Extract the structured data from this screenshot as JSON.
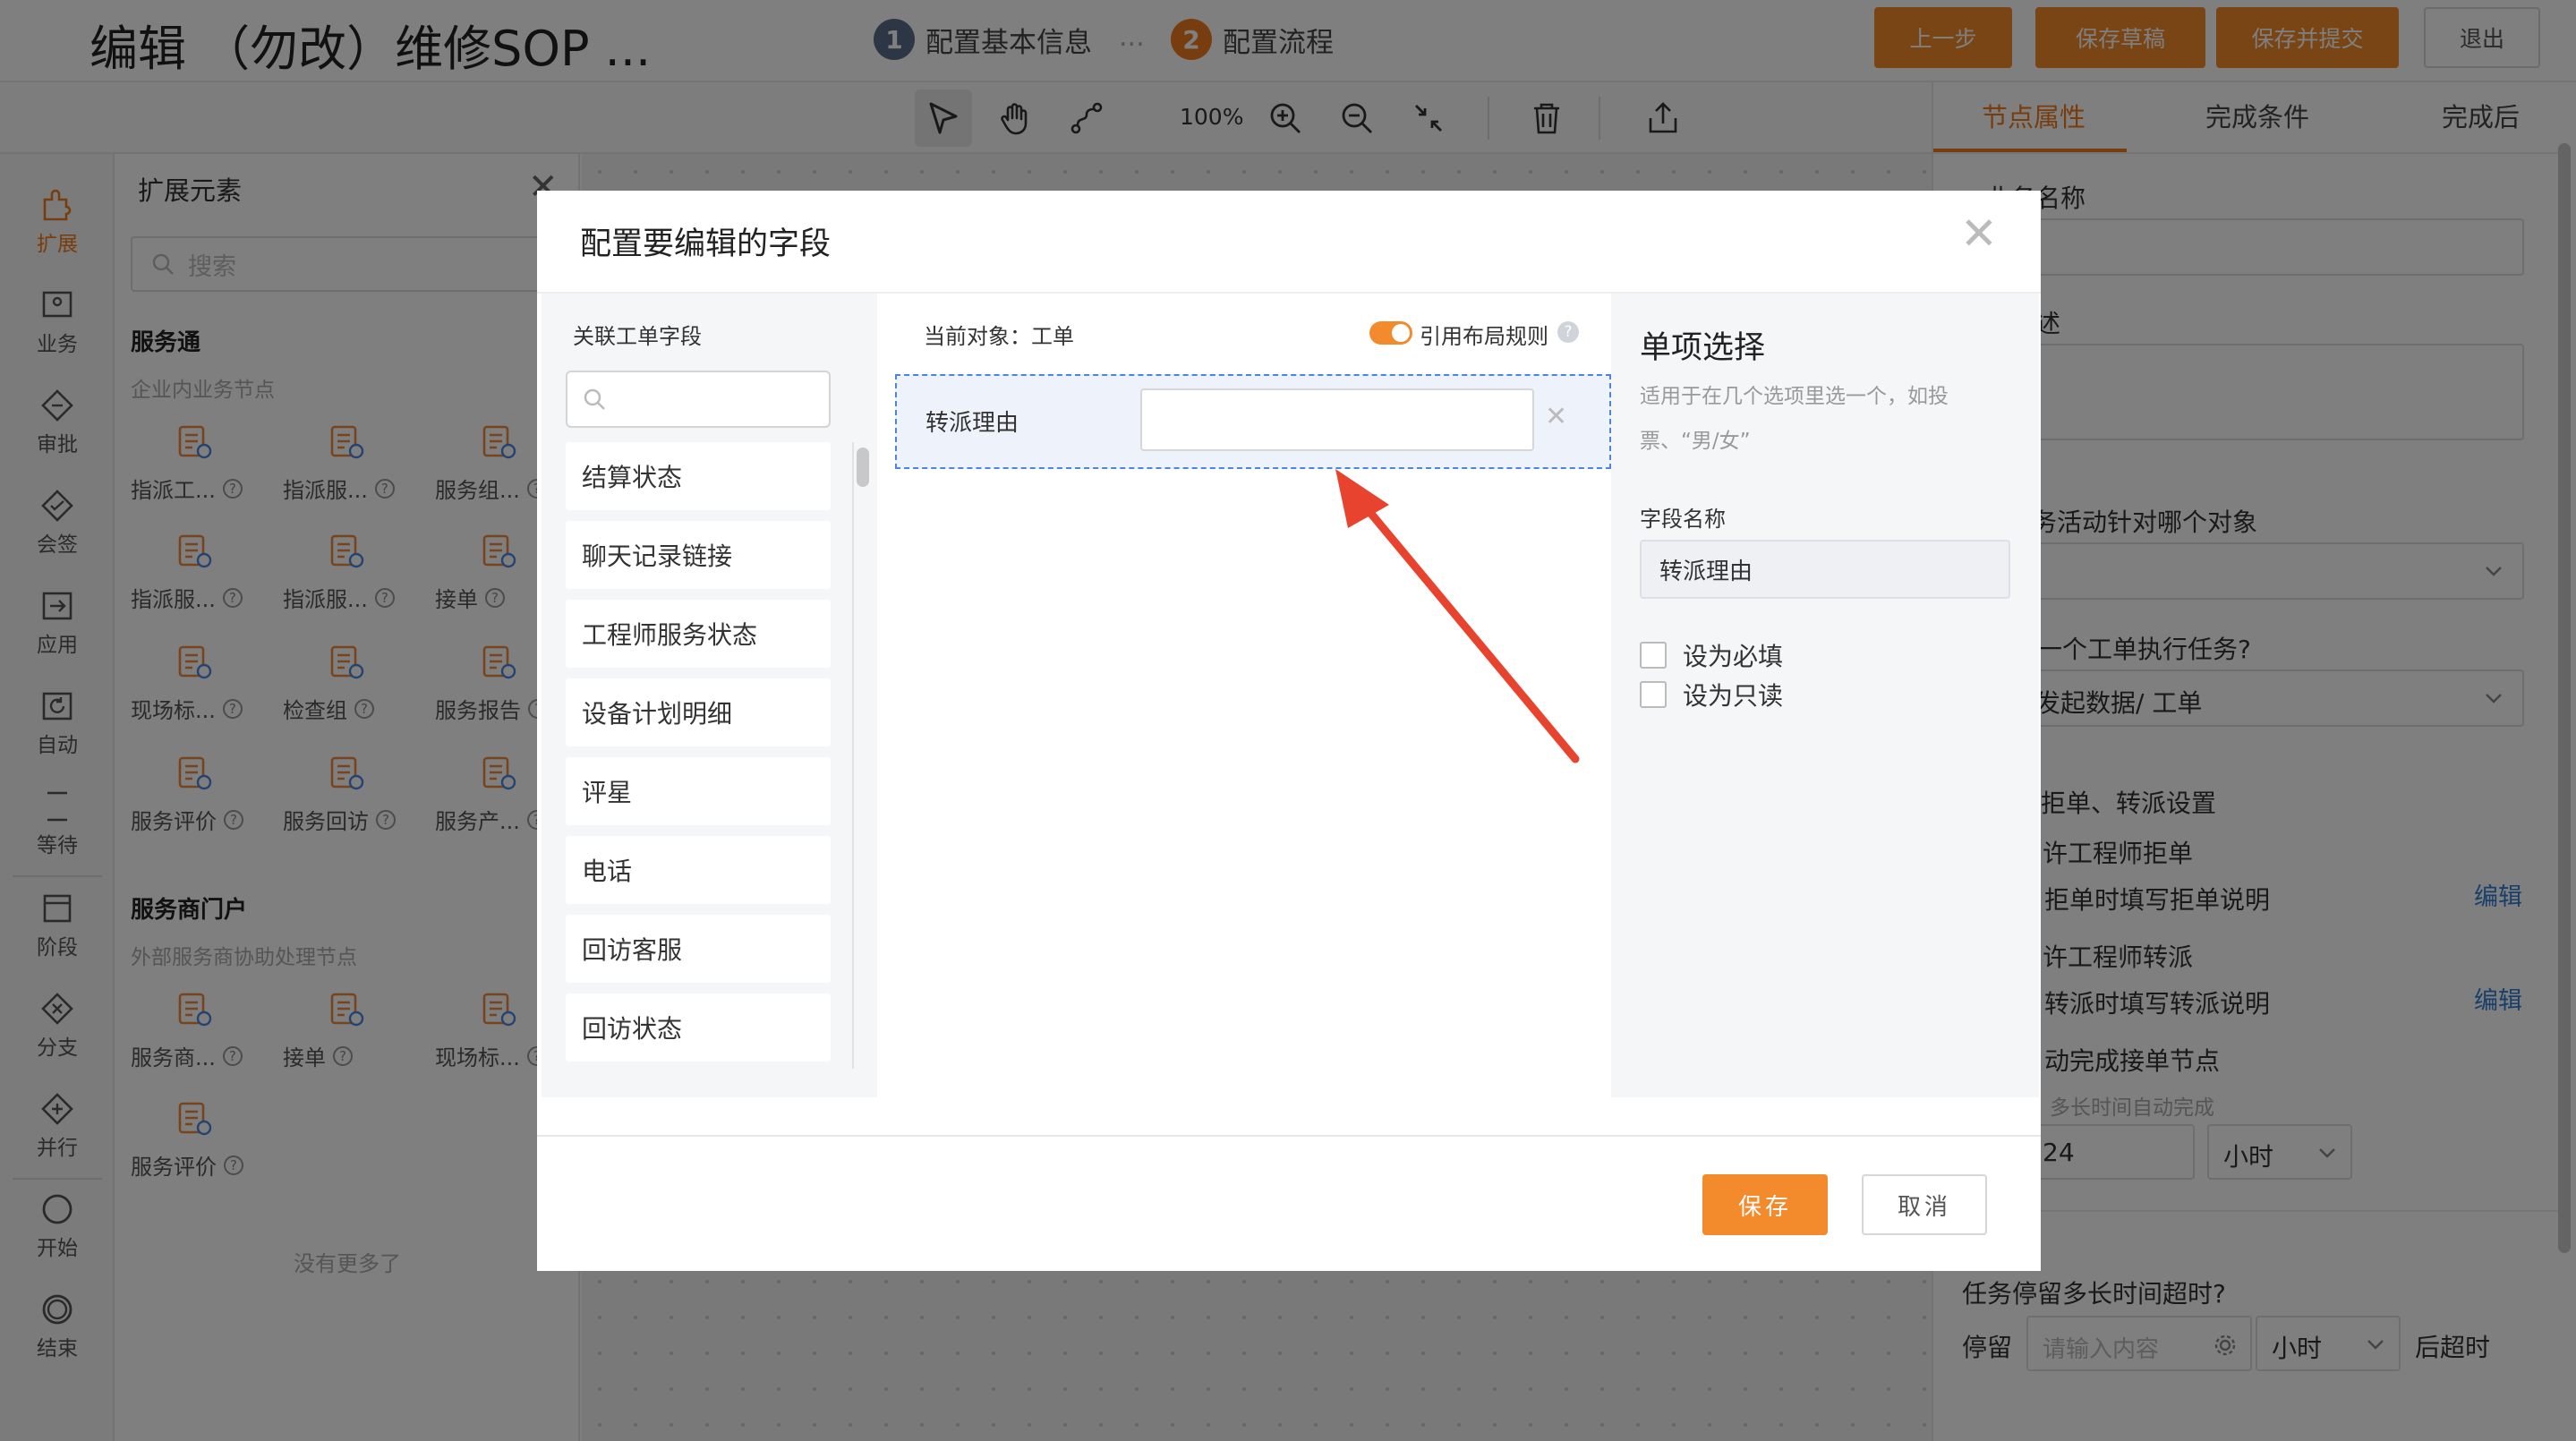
{
  "colors": {
    "accent": "#f38a2b",
    "step1": "#5a6d8a",
    "step2": "#f07b1c",
    "link": "#2f7fd3",
    "arrow": "#e8432e"
  },
  "header": {
    "title": "编辑 （勿改）维修SOP ...",
    "steps": [
      {
        "num": "1",
        "label": "配置基本信息"
      },
      {
        "num": "2",
        "label": "配置流程"
      }
    ],
    "step_dots": "...",
    "buttons": {
      "prev": "上一步",
      "save_draft": "保存草稿",
      "save_submit": "保存并提交",
      "exit": "退出"
    }
  },
  "toolbar": {
    "zoom": "100%",
    "icons": [
      "cursor-icon",
      "hand-icon",
      "connect-icon",
      "zoom-in-icon",
      "zoom-out-icon",
      "fit-icon",
      "trash-icon",
      "export-icon"
    ]
  },
  "rail": {
    "items": [
      {
        "label": "扩展",
        "icon": "puzzle-icon"
      },
      {
        "label": "业务",
        "icon": "person-card-icon"
      },
      {
        "label": "审批",
        "icon": "diamond-icon"
      },
      {
        "label": "会签",
        "icon": "double-diamond-icon"
      },
      {
        "label": "应用",
        "icon": "arrow-box-icon"
      },
      {
        "label": "自动",
        "icon": "refresh-box-icon"
      },
      {
        "label": "等待",
        "icon": "hourglass-icon"
      },
      {
        "label": "阶段",
        "icon": "stage-icon"
      },
      {
        "label": "分支",
        "icon": "branch-icon"
      },
      {
        "label": "并行",
        "icon": "parallel-icon"
      },
      {
        "label": "开始",
        "icon": "start-circle-icon"
      },
      {
        "label": "结束",
        "icon": "end-circle-icon"
      }
    ]
  },
  "extension_panel": {
    "title": "扩展元素",
    "search_placeholder": "搜索",
    "groups": [
      {
        "title": "服务通",
        "desc": "企业内业务节点",
        "nodes": [
          {
            "label": "指派工..."
          },
          {
            "label": "指派服..."
          },
          {
            "label": "服务组..."
          },
          {
            "label": "指派服..."
          },
          {
            "label": "指派服..."
          },
          {
            "label": "接单"
          },
          {
            "label": "现场标..."
          },
          {
            "label": "检查组"
          },
          {
            "label": "服务报告"
          },
          {
            "label": "服务评价"
          },
          {
            "label": "服务回访"
          },
          {
            "label": "服务产..."
          }
        ]
      },
      {
        "title": "服务商门户",
        "desc": "外部服务商协助处理节点",
        "nodes": [
          {
            "label": "服务商..."
          },
          {
            "label": "接单"
          },
          {
            "label": "现场标..."
          },
          {
            "label": "服务评价"
          }
        ]
      }
    ],
    "no_more": "没有更多了"
  },
  "right_panel": {
    "tabs": [
      "节点属性",
      "完成条件",
      "完成后"
    ],
    "lines": {
      "biz_name": "业务名称",
      "desc": "述",
      "target_obj": "务活动针对哪个对象",
      "which_order": "一个工单执行任务?",
      "which_order_value": "发起数据/ 工单",
      "reject_transfer": "拒单、转派设置",
      "allow_reject": "许工程师拒单",
      "reject_note": "拒单时填写拒单说明",
      "allow_transfer": "许工程师转派",
      "transfer_note": "转派时填写转派说明",
      "auto_complete": "动完成接单节点",
      "auto_time": "多长时间自动完成",
      "hours_value": "24",
      "unit_hour": "小时",
      "stay_question": "任务停留多长时间超时?",
      "stay_label": "停留",
      "stay_placeholder": "请输入内容",
      "stay_unit": "小时",
      "timeout_label": "后超时",
      "edit": "编辑"
    }
  },
  "modal": {
    "title": "配置要编辑的字段",
    "left": {
      "title": "关联工单字段",
      "fields": [
        "结算状态",
        "聊天记录链接",
        "工程师服务状态",
        "设备计划明细",
        "评星",
        "电话",
        "回访客服",
        "回访状态"
      ]
    },
    "middle": {
      "current_object": "当前对象：工单",
      "toggle_label": "引用布局规则",
      "toggle_on": true,
      "row_label": "转派理由"
    },
    "right": {
      "type_title": "单项选择",
      "type_desc": "适用于在几个选项里选一个，如投票、“男/女”",
      "field_name_label": "字段名称",
      "field_name_value": "转派理由",
      "required_label": "设为必填",
      "readonly_label": "设为只读"
    },
    "footer": {
      "save": "保存",
      "cancel": "取消"
    }
  }
}
